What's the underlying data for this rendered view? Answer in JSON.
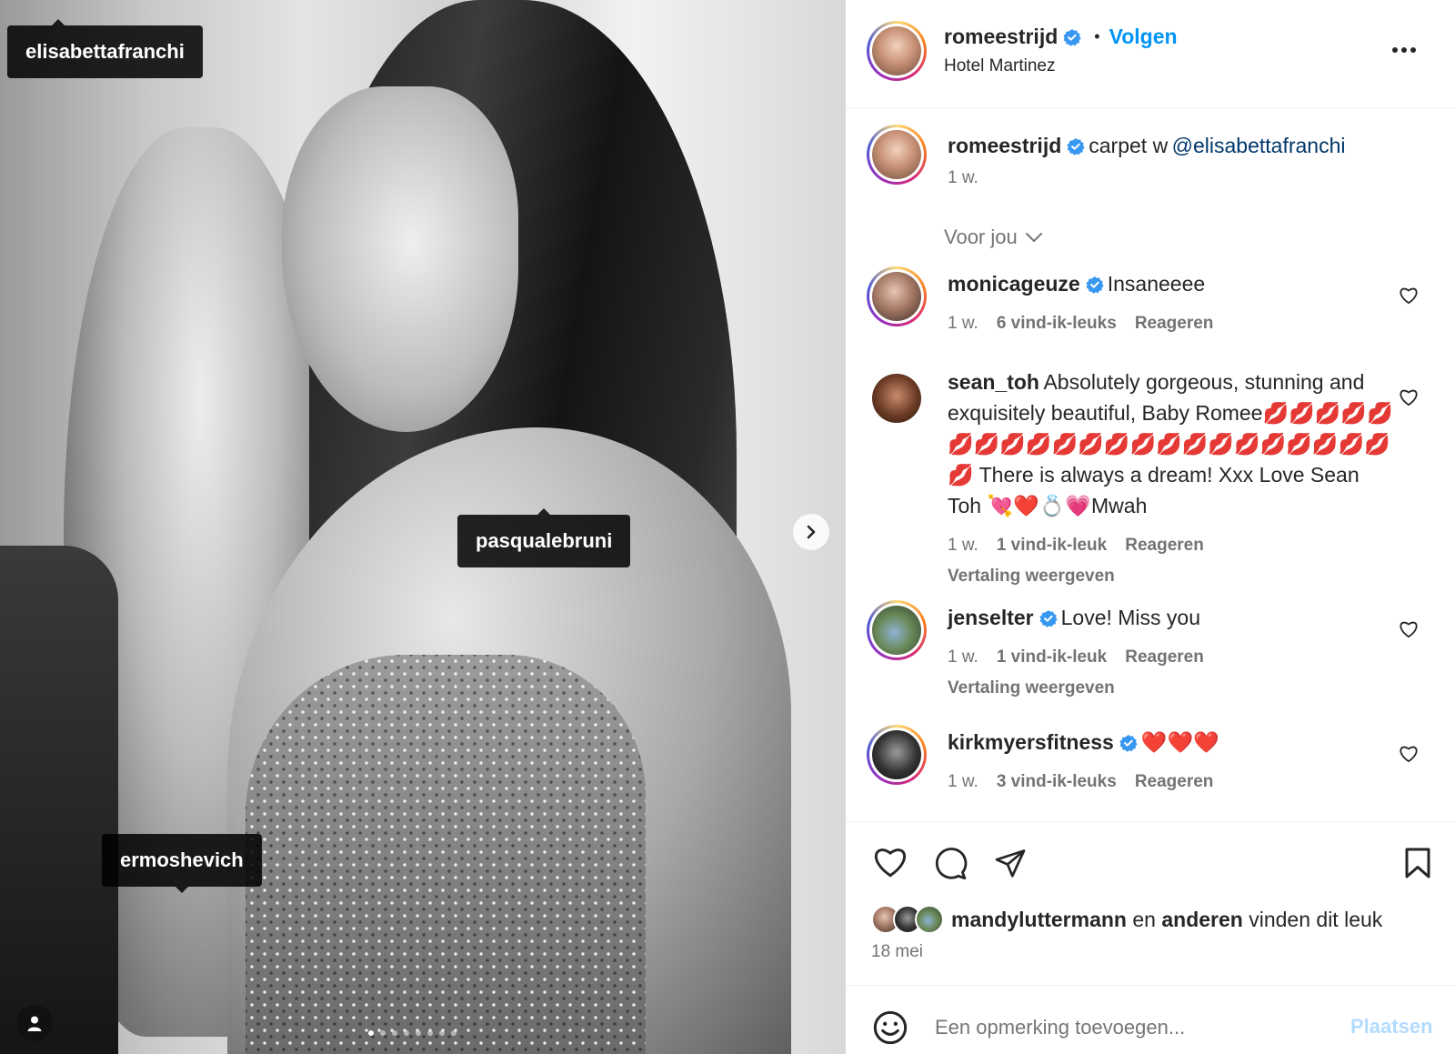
{
  "photo": {
    "tags": [
      "elisabettafranchi",
      "pasqualebruni",
      "ermoshevich"
    ],
    "carousel_total": 8,
    "carousel_active": 1
  },
  "header": {
    "username": "romeestrijd",
    "separator": "•",
    "follow_label": "Volgen",
    "location": "Hotel Martinez",
    "more_icon": "more-horizontal-icon"
  },
  "caption": {
    "username": "romeestrijd",
    "text": "carpet w",
    "mention": "@elisabettafranchi",
    "time": "1 w."
  },
  "filter": {
    "label": "Voor jou"
  },
  "comments": [
    {
      "username": "monicageuze",
      "verified": true,
      "text": "Insaneeee",
      "time": "1 w.",
      "likes": "6 vind-ik-leuks",
      "reply": "Reageren",
      "translate": ""
    },
    {
      "username": "sean_toh",
      "verified": false,
      "text": "Absolutely gorgeous, stunning and exquisitely beautiful, Baby Romee💋💋💋💋💋💋💋💋💋💋💋💋💋💋💋💋💋💋💋💋💋💋💋 There is always a dream! Xxx Love Sean Toh 💘❤️💍💗Mwah",
      "time": "1 w.",
      "likes": "1 vind-ik-leuk",
      "reply": "Reageren",
      "translate": "Vertaling weergeven"
    },
    {
      "username": "jenselter",
      "verified": true,
      "text": "Love! Miss you",
      "time": "1 w.",
      "likes": "1 vind-ik-leuk",
      "reply": "Reageren",
      "translate": "Vertaling weergeven"
    },
    {
      "username": "kirkmyersfitness",
      "verified": true,
      "text": "❤️❤️❤️",
      "time": "1 w.",
      "likes": "3 vind-ik-leuks",
      "reply": "Reageren",
      "translate": ""
    }
  ],
  "likes": {
    "user": "mandyluttermann",
    "mid": "en",
    "others": "anderen",
    "tail": "vinden dit leuk"
  },
  "date": "18 mei",
  "composer": {
    "placeholder": "Een opmerking toevoegen...",
    "post_label": "Plaatsen"
  },
  "colors": {
    "accent": "#0095f6",
    "verified": "#3897f0",
    "text": "#262626",
    "muted": "#737373",
    "post_disabled": "#b3dbff"
  }
}
